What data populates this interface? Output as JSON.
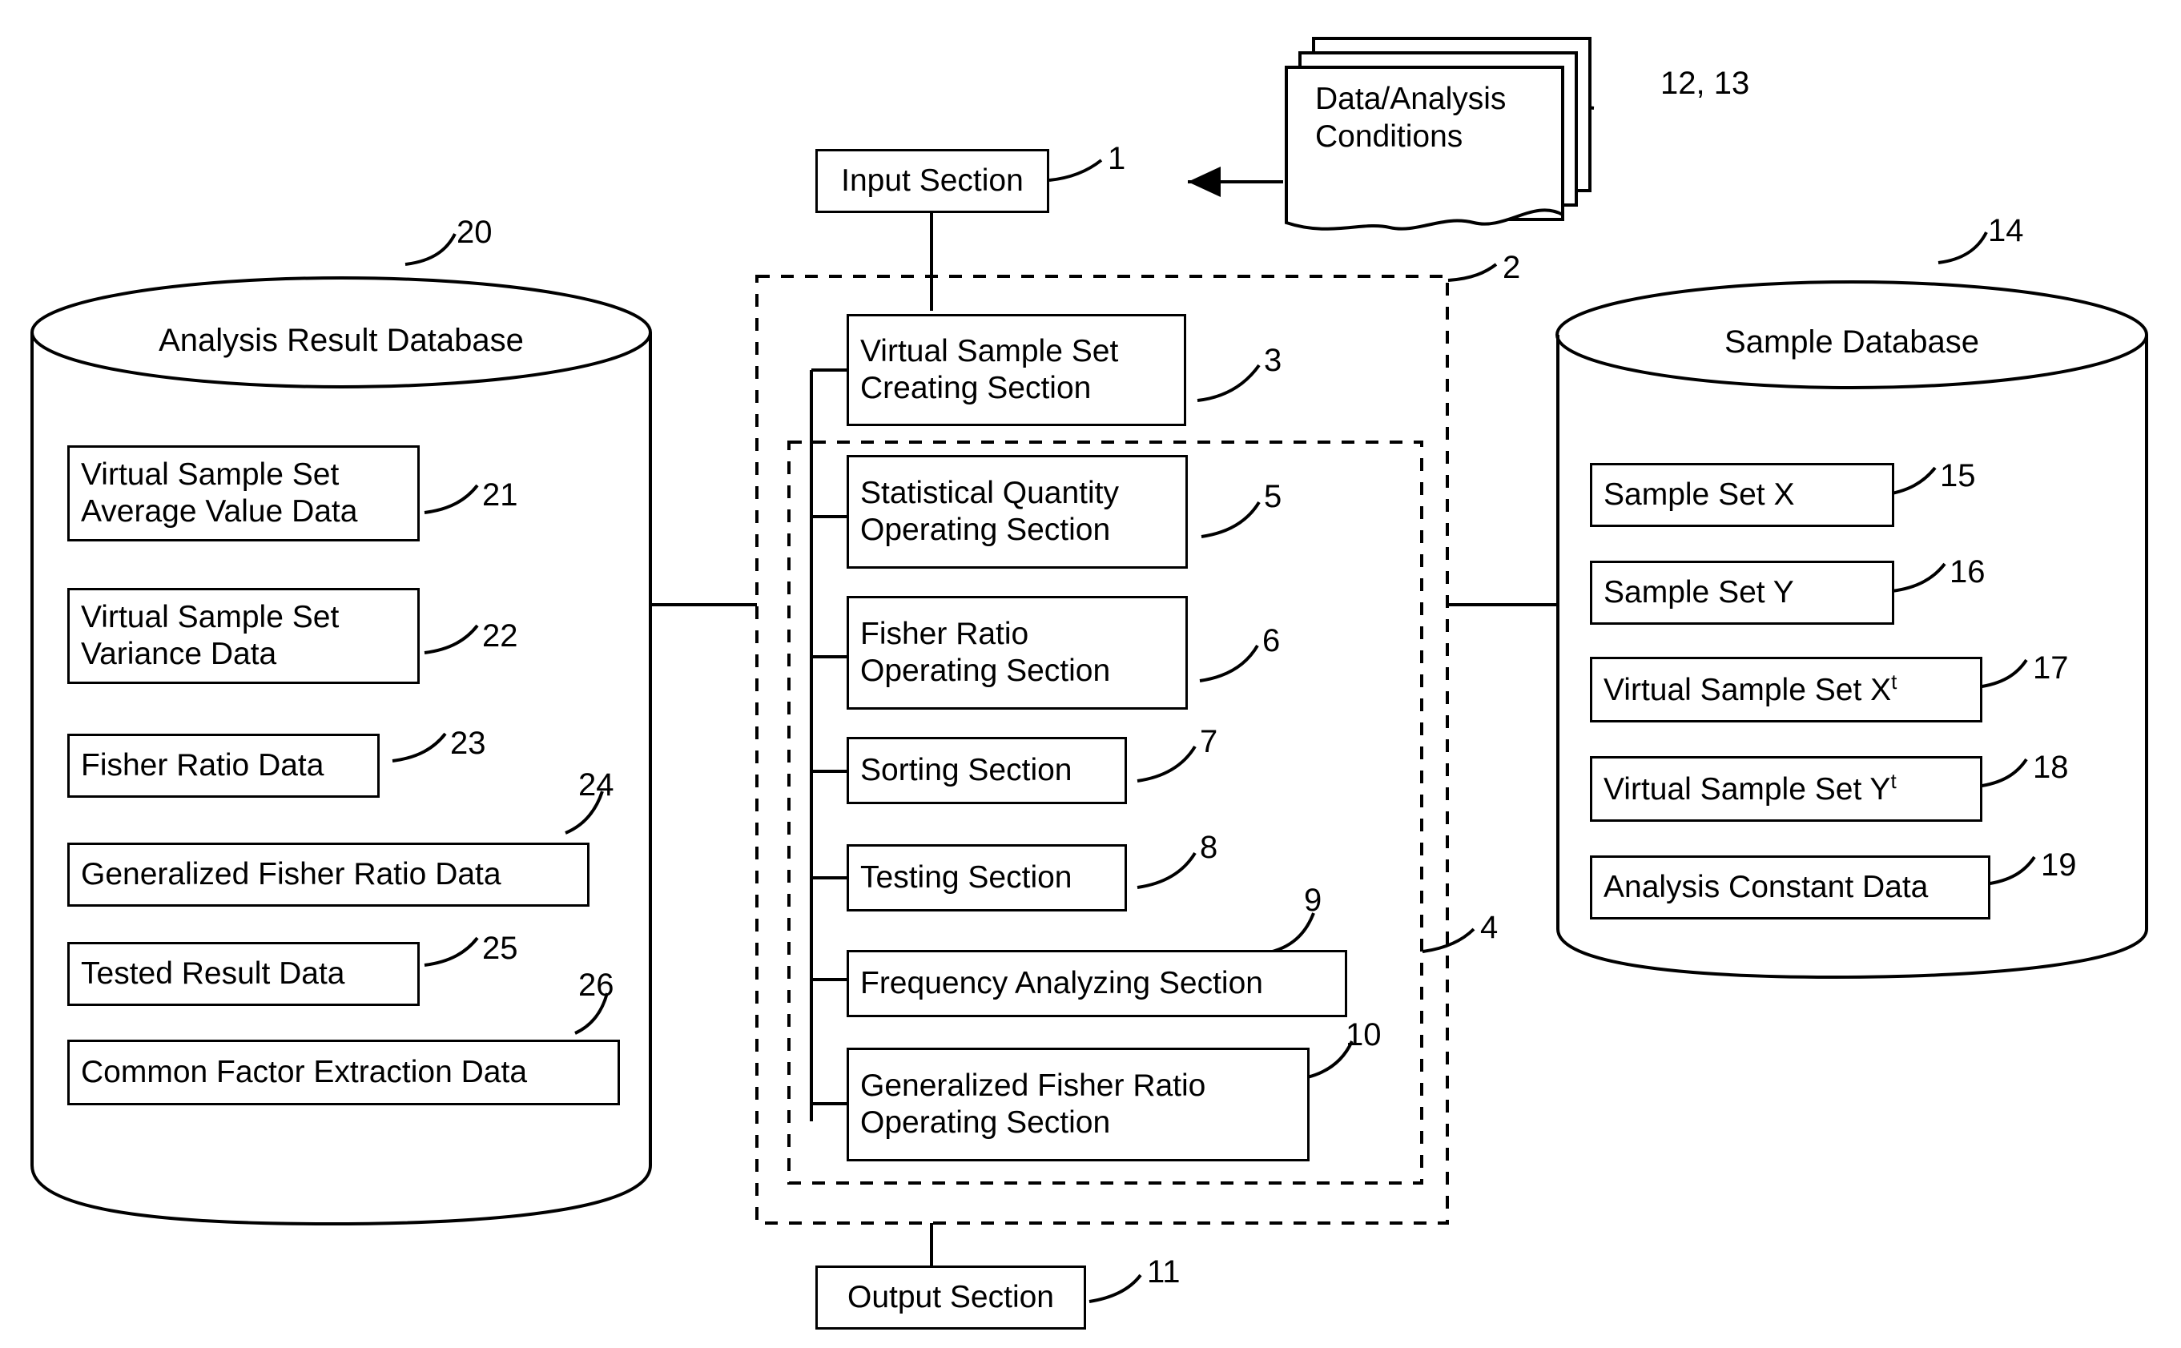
{
  "diagram": {
    "title": "System block diagram",
    "nodes": {
      "input_section": {
        "label": "Input Section",
        "ref": "1"
      },
      "data_analysis_conditions": {
        "label": "Data/Analysis\nConditions",
        "ref": "12, 13"
      },
      "processing_unit": {
        "ref": "2"
      },
      "inner_group": {
        "ref": "4"
      },
      "virtual_sample_set_creating": {
        "label": "Virtual Sample Set\nCreating Section",
        "ref": "3"
      },
      "statistical_quantity_operating": {
        "label": "Statistical Quantity\nOperating Section",
        "ref": "5"
      },
      "fisher_ratio_operating": {
        "label": "Fisher Ratio\nOperating Section",
        "ref": "6"
      },
      "sorting_section": {
        "label": "Sorting Section",
        "ref": "7"
      },
      "testing_section": {
        "label": "Testing Section",
        "ref": "8"
      },
      "frequency_analyzing_section": {
        "label": "Frequency Analyzing Section",
        "ref": "9"
      },
      "generalized_fisher_ratio_operating": {
        "label": "Generalized Fisher Ratio\nOperating Section",
        "ref": "10"
      },
      "output_section": {
        "label": "Output Section",
        "ref": "11"
      }
    },
    "analysis_result_database": {
      "title": "Analysis Result Database",
      "ref": "20",
      "items": [
        {
          "label": "Virtual Sample Set\nAverage Value Data",
          "ref": "21"
        },
        {
          "label": "Virtual Sample Set\nVariance Data",
          "ref": "22"
        },
        {
          "label": "Fisher Ratio Data",
          "ref": "23"
        },
        {
          "label": "Generalized Fisher Ratio Data",
          "ref": "24"
        },
        {
          "label": "Tested Result Data",
          "ref": "25"
        },
        {
          "label": "Common Factor Extraction Data",
          "ref": "26"
        }
      ]
    },
    "sample_database": {
      "title": "Sample Database",
      "ref": "14",
      "items": [
        {
          "label": "Sample Set X",
          "ref": "15"
        },
        {
          "label": "Sample Set Y",
          "ref": "16"
        },
        {
          "label": "Virtual Sample Set X",
          "sup": "t",
          "ref": "17"
        },
        {
          "label": "Virtual Sample Set Y",
          "sup": "t",
          "ref": "18"
        },
        {
          "label": "Analysis Constant Data",
          "ref": "19"
        }
      ]
    }
  }
}
